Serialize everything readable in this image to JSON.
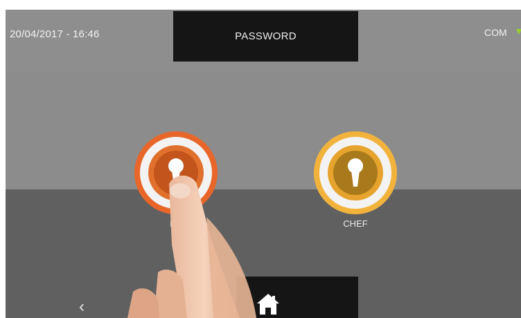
{
  "status_bar": {
    "datetime": "20/04/2017 - 16:46",
    "title": "PASSWORD",
    "connection_label": "COM"
  },
  "roles": [
    {
      "label": "EN",
      "color": "#e8662a"
    },
    {
      "label": "CHEF",
      "color": "#f2b33d"
    }
  ],
  "nav": {
    "back_icon": "chevron-left-icon",
    "home_icon": "home-icon"
  },
  "colors": {
    "background": "#8c8c8c",
    "lower_panel": "#606060",
    "title_box": "#151515",
    "com_indicator": "#9acd32"
  }
}
